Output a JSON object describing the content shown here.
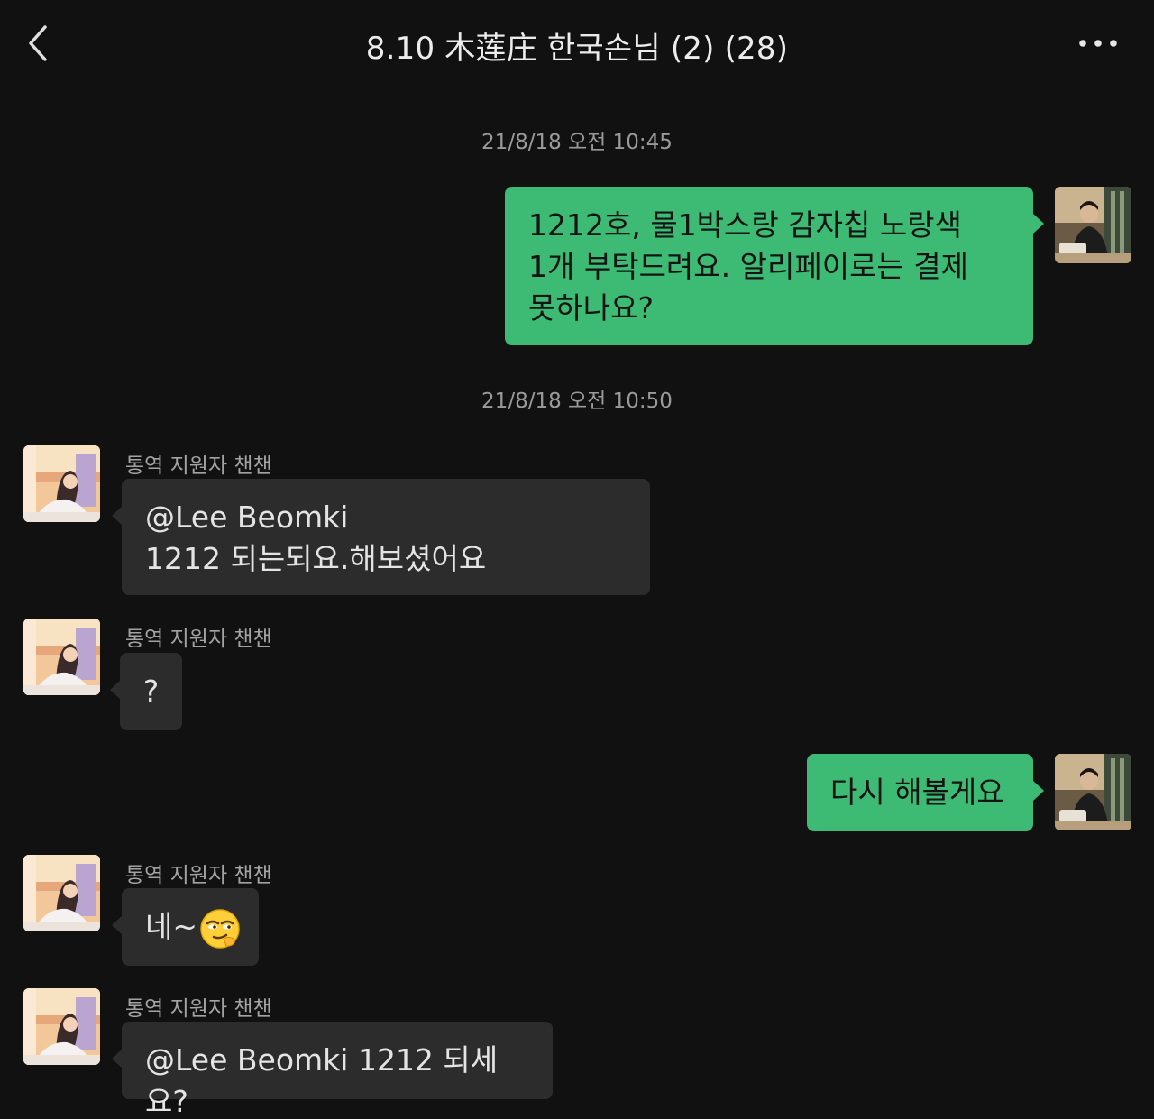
{
  "header": {
    "title": "8.10 木莲庄 한국손님 (2) (28)",
    "back_icon": "chevron-left-icon",
    "more_icon": "more-horizontal-icon"
  },
  "colors": {
    "background": "#111111",
    "outgoing_bubble": "#3dba73",
    "incoming_bubble": "#2c2c2c"
  },
  "timestamps": [
    "21/8/18 오전 10:45",
    "21/8/18 오전 10:50"
  ],
  "messages": [
    {
      "direction": "out",
      "lines": [
        "1212호, 물1박스랑 감자칩 노랑색",
        "1개 부탁드려요. 알리페이로는 결제",
        "못하나요?"
      ]
    },
    {
      "direction": "in",
      "sender": "통역 지원자 챈챈",
      "lines": [
        "@Lee Beomki",
        "1212 되는되요.해보셨어요"
      ]
    },
    {
      "direction": "in",
      "sender": "통역 지원자 챈챈",
      "lines": [
        "?"
      ]
    },
    {
      "direction": "out",
      "lines": [
        "다시 해볼게요"
      ]
    },
    {
      "direction": "in",
      "sender": "통역 지원자 챈챈",
      "lines": [
        "네~"
      ],
      "emoji": "smirk-emoji"
    },
    {
      "direction": "in",
      "sender": "통역 지원자 챈챈",
      "lines": [
        "@Lee Beomki 1212 되세요?"
      ]
    }
  ]
}
